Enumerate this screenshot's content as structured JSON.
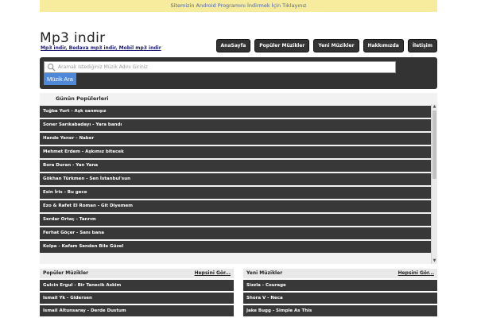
{
  "banner": {
    "text": "Sitemizin Android Programını İndirmek İçin Tıklayınız"
  },
  "header": {
    "logo": "Mp3 indir",
    "tagline": "Mp3 indir, Bedava mp3 indir, Mobil mp3 indir",
    "nav": [
      "AnaSayfa",
      "Popüler Müzikler",
      "Yeni Müzikler",
      "Hakkımızda",
      "İletişim"
    ]
  },
  "search": {
    "placeholder": "Aramak İstediğiniz Müzik Adını Giriniz",
    "value": "",
    "button_label": "Müzik Ara",
    "icon": "search-icon"
  },
  "daily_popular": {
    "title": "Günün Popülerleri",
    "songs": [
      "Tuğba Yurt - Aşk sanmışız",
      "Soner Sarıkabadayı - Yara bandı",
      "Hande Yener - Naber",
      "Mehmet Erdem - Aşkımız bitecek",
      "Bora Duran - Yan Yana",
      "Gökhan Türkmen - Sen İstanbul'sun",
      "Esin İris - Bu gece",
      "Ezo & Rafet El Roman - Git Diyemem",
      "Serdar Ortaç - Tanrım",
      "Ferhat Göçer - Sanı bana",
      "Kolpa - Kafam Senden Bile Güzel"
    ]
  },
  "popular": {
    "title": "Popüler Müzikler",
    "more_label": "Hepsini Gör...",
    "songs": [
      "Gulcin Ergul - Bir Tanecik Askim",
      "Ismail Yk - Gidersen",
      "Ismail Altunsaray - Derde Dustum"
    ]
  },
  "new_music": {
    "title": "Yeni Müzikler",
    "more_label": "Hepsini Gör...",
    "songs": [
      "Sizzla - Courage",
      "Shora V - Neca",
      "Jake Bugg - Simple As This"
    ]
  }
}
